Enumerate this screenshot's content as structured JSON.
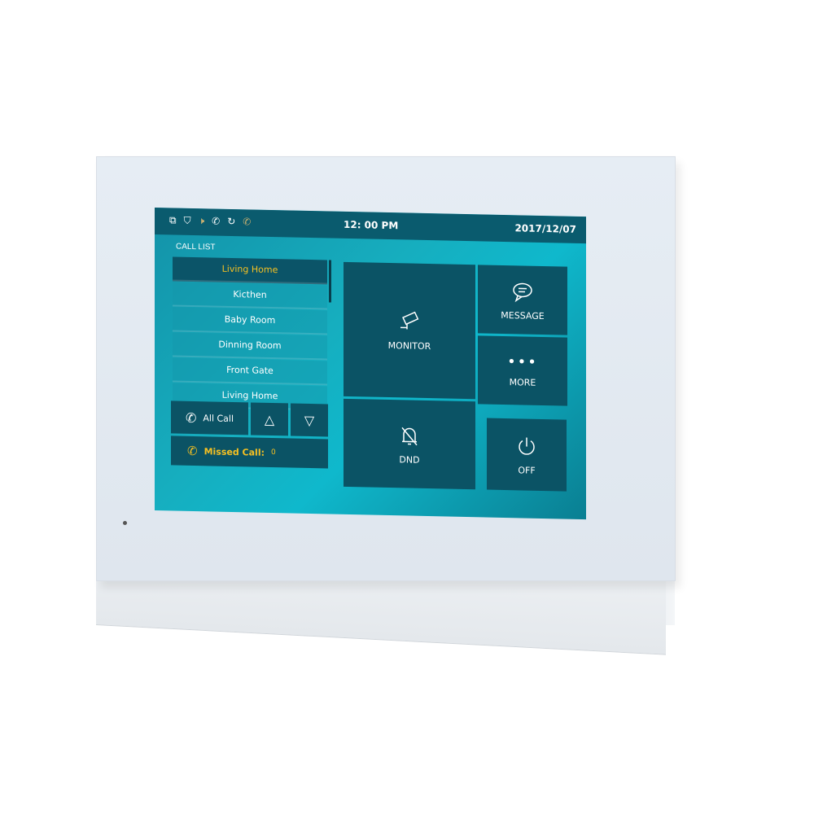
{
  "status_bar": {
    "icons": [
      "copy-icon",
      "shield-icon",
      "mute-icon",
      "auto-answer-icon",
      "forward-icon",
      "phone-icon"
    ],
    "time": "12: 00  PM",
    "date": "2017/12/07"
  },
  "call_list": {
    "title": "CALL LIST",
    "items": [
      {
        "label": "Living Home",
        "selected": true
      },
      {
        "label": "Kicthen"
      },
      {
        "label": "Baby Room"
      },
      {
        "label": "Dinning Room"
      },
      {
        "label": "Front Gate"
      },
      {
        "label": "Living Home"
      }
    ]
  },
  "controls": {
    "all_call": "All Call",
    "missed_call_label": "Missed Call:",
    "missed_call_count": "0"
  },
  "tiles": {
    "monitor": "MONITOR",
    "message": "MESSAGE",
    "more": "MORE",
    "dnd": "DND",
    "off": "OFF"
  },
  "colors": {
    "accent": "#f5c022",
    "tile": "#0b5365",
    "status_bar": "#0a5b6e"
  }
}
